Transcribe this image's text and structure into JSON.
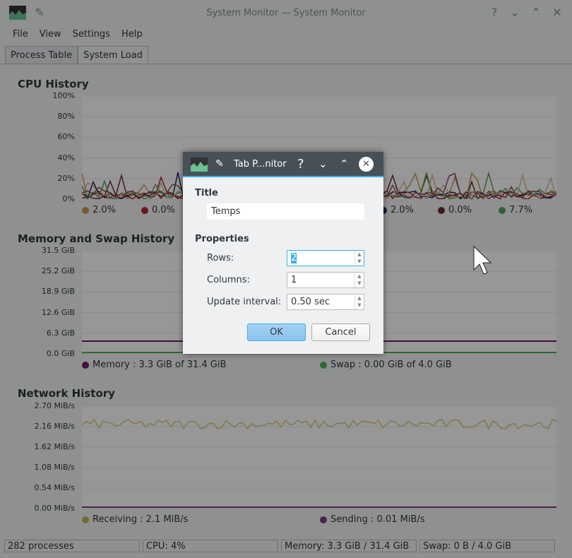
{
  "window": {
    "title": "System Monitor — System Monitor"
  },
  "menu": [
    "File",
    "View",
    "Settings",
    "Help"
  ],
  "tabs": [
    "Process Table",
    "System Load"
  ],
  "cpu": {
    "title": "CPU History",
    "yticks": [
      "100%",
      "80%",
      "60%",
      "40%",
      "20%",
      "0%"
    ],
    "legend": [
      {
        "value": "2.0%",
        "color": "#c8965a"
      },
      {
        "value": "0.0%",
        "color": "#b3262e"
      },
      {
        "value": "2.0%",
        "color": "#1c2b5a"
      },
      {
        "value": "0.0%",
        "color": "#6b2a33"
      },
      {
        "value": "7.7%",
        "color": "#56a04f"
      }
    ]
  },
  "memory": {
    "title": "Memory and Swap History",
    "yticks": [
      "31.5 GiB",
      "25.2 GiB",
      "18.9 GiB",
      "12.6 GiB",
      "6.3 GiB",
      "0.0 GiB"
    ],
    "legend": [
      {
        "label": "Memory : 3.3 GiB of 31.4 GiB",
        "color": "#7b1a6b"
      },
      {
        "label": "Swap : 0.00 GiB of 4.0 GiB",
        "color": "#4caf50"
      }
    ]
  },
  "network": {
    "title": "Network History",
    "yticks": [
      "2.70 MiB/s",
      "2.16 MiB/s",
      "1.62 MiB/s",
      "1.08 MiB/s",
      "0.54 MiB/s",
      "0.00 MiB/s"
    ],
    "legend": [
      {
        "label": "Receiving : 2.1 MiB/s",
        "color": "#c0b060"
      },
      {
        "label": "Sending : 0.01 MiB/s",
        "color": "#7b3a8b"
      }
    ]
  },
  "status": [
    "282 processes",
    "CPU: 4%",
    "Memory: 3.3 GiB / 31.4 GiB",
    "Swap: 0 B / 4.0 GiB"
  ],
  "dialog": {
    "title": "Tab P...nitor",
    "title_section": "Title",
    "title_value": "Temps",
    "properties": "Properties",
    "rows_label": "Rows:",
    "rows_value": "2",
    "columns_label": "Columns:",
    "columns_value": "1",
    "interval_label": "Update interval:",
    "interval_value": "0.50 sec",
    "ok": "OK",
    "cancel": "Cancel"
  }
}
